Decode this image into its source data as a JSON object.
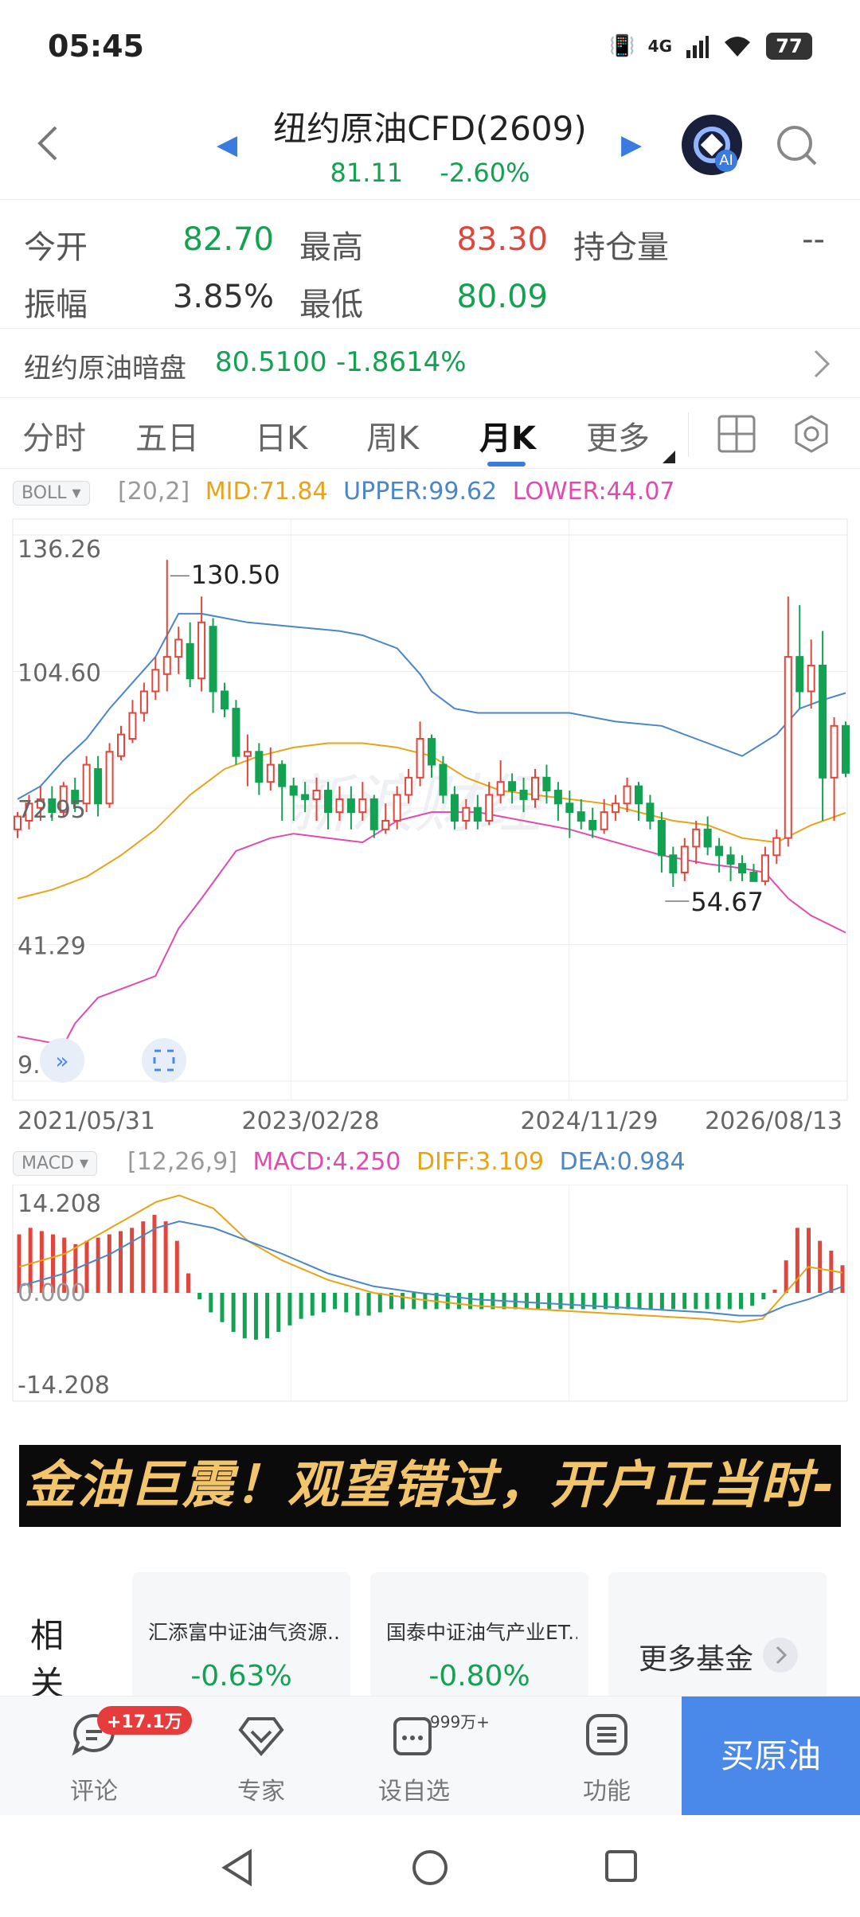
{
  "status_bar": {
    "time": "05:45",
    "network": "4G",
    "battery": "77"
  },
  "header": {
    "title": "纽约原油CFD(2609)",
    "price": "81.11",
    "change_pct": "-2.60%"
  },
  "stats": [
    {
      "label": "今开",
      "value": "82.70",
      "color": "green"
    },
    {
      "label": "最高",
      "value": "83.30",
      "color": "red"
    },
    {
      "label": "持仓量",
      "value": "--",
      "color": "gray"
    },
    {
      "label": "振幅",
      "value": "3.85%",
      "color": "dark"
    },
    {
      "label": "最低",
      "value": "80.09",
      "color": "green"
    }
  ],
  "dark_market": {
    "label": "纽约原油暗盘",
    "price": "80.5100",
    "change": "-1.8614%"
  },
  "tabs": [
    "分时",
    "五日",
    "日K",
    "周K",
    "月K",
    "更多"
  ],
  "active_tab": "月K",
  "boll": {
    "name": "BOLL",
    "params": "[20,2]",
    "mid": "MID:71.84",
    "upper": "UPPER:99.62",
    "lower": "LOWER:44.07"
  },
  "macd": {
    "name": "MACD",
    "params": "[12,26,9]",
    "macd": "MACD:4.250",
    "diff": "DIFF:3.109",
    "dea": "DEA:0.984"
  },
  "watermark": "新浪财经",
  "banner_text": "金油巨震！观望错过，开户正当时->",
  "funds": {
    "label": "相关基金",
    "items": [
      {
        "name": "汇添富中证油气资源...",
        "change": "-0.63%"
      },
      {
        "name": "国泰中证油气产业ET...",
        "change": "-0.80%"
      }
    ],
    "more": "更多基金"
  },
  "bottom_bar": {
    "comment": "评论",
    "comment_badge": "+17.1万",
    "expert": "专家",
    "watchlist": "设自选",
    "watch_badge": "999万+",
    "functions": "功能",
    "buy": "买原油"
  },
  "colors": {
    "up": "#e0463b",
    "down": "#13a152",
    "accent": "#3a7be0",
    "mid": "#e8a317",
    "upper": "#4a86c8",
    "lower": "#e04bb0"
  },
  "chart_data": [
    {
      "type": "candlestick",
      "title": "",
      "y_ticks": [
        136.26,
        104.6,
        72.95,
        41.29,
        9.64
      ],
      "ylim": [
        9.64,
        136.26
      ],
      "x_ticks": [
        "2021/05/31",
        "2023/02/28",
        "2024/11/29",
        "2026/08/13"
      ],
      "max_label": "130.50",
      "min_label": "54.67",
      "grid": true,
      "candles": [
        [
          68,
          71,
          66,
          72
        ],
        [
          70,
          74,
          68,
          76
        ],
        [
          73,
          75,
          70,
          78
        ],
        [
          75,
          72,
          70,
          78
        ],
        [
          72,
          78,
          71,
          79
        ],
        [
          77,
          74,
          72,
          80
        ],
        [
          74,
          83,
          72,
          85
        ],
        [
          82,
          74,
          71,
          85
        ],
        [
          74,
          86,
          73,
          88
        ],
        [
          85,
          90,
          84,
          92
        ],
        [
          89,
          95,
          88,
          98
        ],
        [
          95,
          100,
          93,
          102
        ],
        [
          100,
          105,
          98,
          108
        ],
        [
          104,
          108,
          100,
          130.5
        ],
        [
          108,
          112,
          104,
          115
        ],
        [
          111,
          103,
          101,
          116
        ],
        [
          103,
          116,
          100,
          122
        ],
        [
          115,
          100,
          95,
          117
        ],
        [
          100,
          96,
          94,
          102
        ],
        [
          96,
          85,
          83,
          98
        ],
        [
          85,
          86,
          78,
          90
        ],
        [
          86,
          79,
          76,
          88
        ],
        [
          79,
          83,
          77,
          87
        ],
        [
          83,
          78,
          70,
          84
        ],
        [
          78,
          76,
          70,
          80
        ],
        [
          76,
          75,
          72,
          79
        ],
        [
          75,
          77,
          70,
          80
        ],
        [
          77,
          72,
          68,
          79
        ],
        [
          72,
          75,
          70,
          78
        ],
        [
          75,
          72,
          68,
          78
        ],
        [
          72,
          75,
          70,
          79
        ],
        [
          75,
          68,
          66,
          76
        ],
        [
          68,
          70,
          67,
          74
        ],
        [
          70,
          76,
          68,
          78
        ],
        [
          76,
          80,
          74,
          82
        ],
        [
          80,
          89,
          78,
          93
        ],
        [
          89,
          83,
          80,
          90
        ],
        [
          83,
          76,
          74,
          85
        ],
        [
          76,
          70,
          68,
          78
        ],
        [
          70,
          73,
          68,
          75
        ],
        [
          73,
          70,
          68,
          76
        ],
        [
          70,
          76,
          69,
          79
        ],
        [
          76,
          79,
          74,
          84
        ],
        [
          79,
          77,
          74,
          81
        ],
        [
          77,
          75,
          72,
          80
        ],
        [
          75,
          80,
          73,
          82
        ],
        [
          80,
          77,
          74,
          83
        ],
        [
          77,
          74,
          70,
          79
        ],
        [
          74,
          72,
          66,
          77
        ],
        [
          72,
          70,
          68,
          75
        ],
        [
          70,
          68,
          66,
          73
        ],
        [
          68,
          72,
          67,
          75
        ],
        [
          72,
          74,
          70,
          76
        ],
        [
          74,
          78,
          72,
          80
        ],
        [
          78,
          74,
          70,
          79
        ],
        [
          74,
          70,
          68,
          76
        ],
        [
          70,
          62,
          58,
          72
        ],
        [
          62,
          58,
          54.67,
          64
        ],
        [
          58,
          64,
          56,
          66
        ],
        [
          64,
          68,
          60,
          70
        ],
        [
          68,
          64,
          62,
          71
        ],
        [
          64,
          62,
          58,
          66
        ],
        [
          62,
          60,
          56,
          64
        ],
        [
          60,
          58,
          56,
          62
        ],
        [
          58,
          56,
          56,
          60
        ],
        [
          56,
          62,
          55,
          64
        ],
        [
          62,
          66,
          60,
          68
        ],
        [
          66,
          108,
          64,
          122
        ],
        [
          108,
          100,
          96,
          120
        ],
        [
          100,
          106,
          96,
          112
        ],
        [
          106,
          80,
          70,
          114
        ],
        [
          80,
          92,
          70,
          94
        ],
        [
          92,
          81.11,
          80.09,
          93
        ]
      ],
      "boll_mid": [
        [
          0,
          52
        ],
        [
          3,
          54
        ],
        [
          6,
          57
        ],
        [
          9,
          62
        ],
        [
          12,
          68
        ],
        [
          15,
          76
        ],
        [
          18,
          82
        ],
        [
          21,
          85
        ],
        [
          24,
          87
        ],
        [
          27,
          88
        ],
        [
          30,
          88
        ],
        [
          33,
          87
        ],
        [
          36,
          85
        ],
        [
          39,
          80
        ],
        [
          42,
          77
        ],
        [
          45,
          76
        ],
        [
          48,
          75
        ],
        [
          51,
          74
        ],
        [
          54,
          72
        ],
        [
          57,
          70
        ],
        [
          60,
          69
        ],
        [
          63,
          66
        ],
        [
          66,
          65
        ],
        [
          69,
          69
        ],
        [
          72,
          71.84
        ]
      ],
      "boll_upper": [
        [
          0,
          75
        ],
        [
          2,
          78
        ],
        [
          4,
          84
        ],
        [
          6,
          89
        ],
        [
          8,
          96
        ],
        [
          10,
          102
        ],
        [
          12,
          108
        ],
        [
          14,
          118
        ],
        [
          16,
          118
        ],
        [
          20,
          116
        ],
        [
          24,
          115
        ],
        [
          28,
          114
        ],
        [
          30,
          113
        ],
        [
          33,
          110
        ],
        [
          35,
          104
        ],
        [
          36,
          100
        ],
        [
          38,
          96
        ],
        [
          40,
          95
        ],
        [
          44,
          95
        ],
        [
          48,
          95
        ],
        [
          52,
          93
        ],
        [
          56,
          92
        ],
        [
          60,
          88
        ],
        [
          63,
          85
        ],
        [
          66,
          90
        ],
        [
          68,
          96
        ],
        [
          70,
          98
        ],
        [
          72,
          99.62
        ]
      ],
      "boll_lower": [
        [
          0,
          20
        ],
        [
          2,
          19
        ],
        [
          4,
          18
        ],
        [
          5,
          23
        ],
        [
          7,
          29
        ],
        [
          10,
          32
        ],
        [
          12,
          34
        ],
        [
          14,
          45
        ],
        [
          16,
          52
        ],
        [
          19,
          63
        ],
        [
          22,
          66
        ],
        [
          24,
          67
        ],
        [
          27,
          66
        ],
        [
          30,
          65
        ],
        [
          33,
          70
        ],
        [
          36,
          72
        ],
        [
          40,
          72
        ],
        [
          44,
          70
        ],
        [
          48,
          68
        ],
        [
          52,
          65
        ],
        [
          56,
          62
        ],
        [
          60,
          60
        ],
        [
          63,
          59
        ],
        [
          65,
          58
        ],
        [
          67,
          52
        ],
        [
          69,
          48
        ],
        [
          72,
          44.07
        ]
      ]
    },
    {
      "type": "bar",
      "title": "",
      "y_ticks": [
        14.208,
        0.0,
        -14.208
      ],
      "ylim": [
        -14.208,
        14.208
      ],
      "macd_values": [
        9,
        10,
        9.5,
        9,
        8.5,
        7.5,
        8,
        8.5,
        9,
        9.5,
        10,
        11,
        12,
        11,
        8,
        3,
        -1,
        -3,
        -4.5,
        -6,
        -7,
        -7.2,
        -7,
        -6,
        -5,
        -4,
        -3.5,
        -3,
        -2.5,
        -3,
        -3.5,
        -3.5,
        -3,
        -2.5,
        -2.5,
        -2.5,
        -2.5,
        -2.5,
        -2.5,
        -2.5,
        -2.5,
        -2.5,
        -2.5,
        -2.5,
        -2.5,
        -2.5,
        -2.5,
        -2.5,
        -2.5,
        -2.5,
        -2.5,
        -2.5,
        -2.5,
        -2.5,
        -2.5,
        -2.5,
        -2.5,
        -2.5,
        -2.5,
        -2.5,
        -2.5,
        -2.5,
        -2.5,
        -2.5,
        -2.5,
        -2,
        -1,
        0.5,
        5,
        10,
        10,
        8,
        6.5,
        4.25
      ],
      "diff": [
        [
          0,
          4
        ],
        [
          4,
          6
        ],
        [
          8,
          10
        ],
        [
          12,
          14
        ],
        [
          14,
          15
        ],
        [
          17,
          13
        ],
        [
          20,
          8
        ],
        [
          23,
          5
        ],
        [
          27,
          2
        ],
        [
          31,
          0
        ],
        [
          35,
          -1
        ],
        [
          40,
          -2
        ],
        [
          45,
          -2.5
        ],
        [
          50,
          -3
        ],
        [
          55,
          -3.5
        ],
        [
          60,
          -4
        ],
        [
          63,
          -4.5
        ],
        [
          65,
          -4
        ],
        [
          67,
          0
        ],
        [
          69,
          4
        ],
        [
          72,
          3.109
        ]
      ],
      "dea": [
        [
          0,
          1
        ],
        [
          4,
          3
        ],
        [
          8,
          6
        ],
        [
          12,
          10
        ],
        [
          14,
          11
        ],
        [
          17,
          10
        ],
        [
          20,
          8
        ],
        [
          23,
          6
        ],
        [
          27,
          3
        ],
        [
          31,
          1
        ],
        [
          35,
          0
        ],
        [
          40,
          -1
        ],
        [
          45,
          -1.5
        ],
        [
          50,
          -2
        ],
        [
          55,
          -2.5
        ],
        [
          60,
          -3
        ],
        [
          63,
          -3.5
        ],
        [
          65,
          -3.5
        ],
        [
          67,
          -2
        ],
        [
          69,
          -1
        ],
        [
          72,
          0.984
        ]
      ]
    }
  ]
}
